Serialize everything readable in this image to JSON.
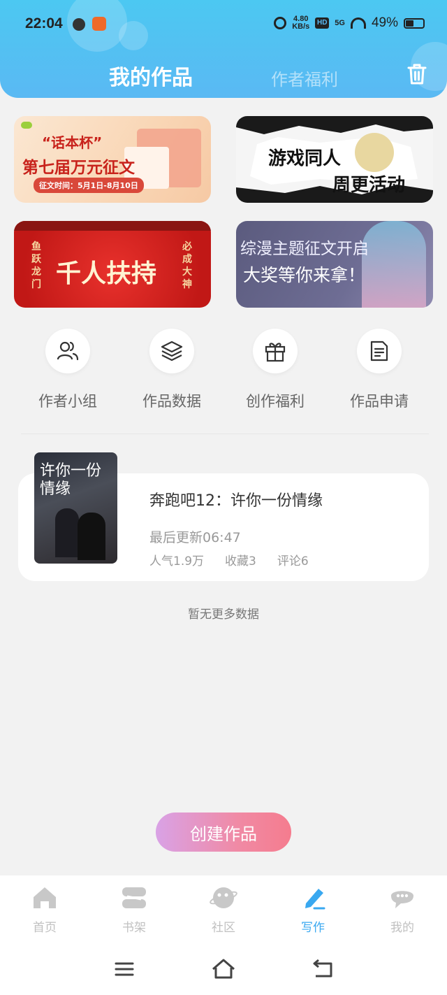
{
  "status_bar": {
    "time": "22:04",
    "net_speed_value": "4.80",
    "net_speed_unit": "KB/s",
    "hd_label": "HD",
    "signal_label": "5G",
    "battery": "49%"
  },
  "header": {
    "tab_active": "我的作品",
    "tab_other": "作者福利"
  },
  "banners": [
    {
      "line1": "“话本杯”",
      "line2": "第七届万元征文",
      "line3": "征文时间：5月1日-8月10日"
    },
    {
      "line1": "游戏同人",
      "line2": "周更活动"
    },
    {
      "line1": "千人扶持",
      "left_tag": "鱼跃龙门",
      "right_tag": "必成大神"
    },
    {
      "line1": "综漫主题征文开启",
      "line2": "大奖等你来拿！"
    }
  ],
  "quick_actions": [
    {
      "label": "作者小组",
      "icon": "users-icon"
    },
    {
      "label": "作品数据",
      "icon": "layers-icon"
    },
    {
      "label": "创作福利",
      "icon": "gift-icon"
    },
    {
      "label": "作品申请",
      "icon": "document-icon"
    }
  ],
  "work": {
    "cover_text": "许你一份情缘",
    "title": "奔跑吧12：许你一份情缘",
    "last_update": "最后更新06:47",
    "popularity": "人气1.9万",
    "favorites": "收藏3",
    "comments": "评论6"
  },
  "no_more_text": "暂无更多数据",
  "create_button": "创建作品",
  "bottom_nav": [
    {
      "label": "首页",
      "icon": "home-icon"
    },
    {
      "label": "书架",
      "icon": "bookshelf-icon"
    },
    {
      "label": "社区",
      "icon": "community-icon"
    },
    {
      "label": "写作",
      "icon": "pen-icon",
      "active": true
    },
    {
      "label": "我的",
      "icon": "profile-chat-icon"
    }
  ],
  "colors": {
    "header_blue": "#4cc8f2",
    "active_nav": "#39a8f0",
    "create_gradient_start": "#d9a2e6",
    "create_gradient_end": "#f57c8e"
  }
}
